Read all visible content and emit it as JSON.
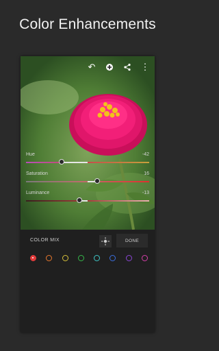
{
  "headline": "Color Enhancements",
  "toolbar": {
    "undo_icon": "undo-icon",
    "add_icon": "add-icon",
    "share_icon": "share-icon",
    "more_icon": "more-icon"
  },
  "panel": {
    "title": "COLOR MIX",
    "done_label": "DONE",
    "swatches": [
      {
        "name": "red",
        "color": "#e13b3b",
        "selected": true
      },
      {
        "name": "orange",
        "color": "#e8782e",
        "selected": false
      },
      {
        "name": "yellow",
        "color": "#d8c23a",
        "selected": false
      },
      {
        "name": "green",
        "color": "#36b84a",
        "selected": false
      },
      {
        "name": "aqua",
        "color": "#3fc7c7",
        "selected": false
      },
      {
        "name": "blue",
        "color": "#3b6fe0",
        "selected": false
      },
      {
        "name": "purple",
        "color": "#8b46d6",
        "selected": false
      },
      {
        "name": "magenta",
        "color": "#d63fa9",
        "selected": false
      }
    ],
    "sliders": [
      {
        "label": "Hue",
        "value": "-42",
        "amount": -42
      },
      {
        "label": "Saturation",
        "value": "16",
        "amount": 16
      },
      {
        "label": "Luminance",
        "value": "-13",
        "amount": -13
      }
    ]
  }
}
